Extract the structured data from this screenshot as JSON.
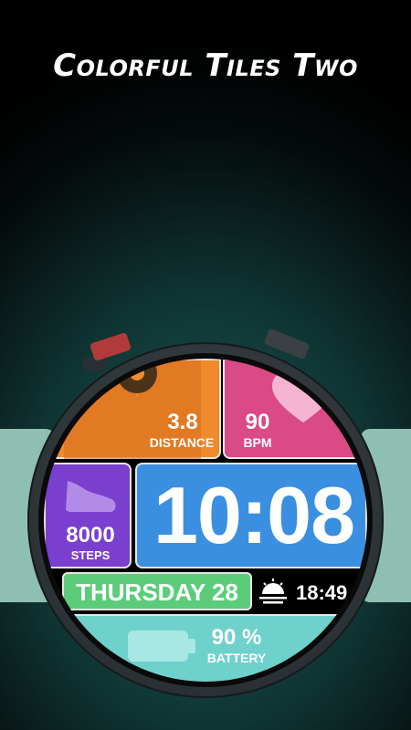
{
  "title": "Colorful Tiles Two",
  "distance": {
    "value": "3.8",
    "label": "DISTANCE"
  },
  "heart": {
    "value": "90",
    "label": "BPM"
  },
  "steps": {
    "value": "8000",
    "label": "STEPS"
  },
  "time": "10:08",
  "date": "THURSDAY 28",
  "sunset_time": "18:49",
  "battery": {
    "value": "90 %",
    "label": "BATTERY",
    "level": 0.9
  },
  "colors": {
    "distance_tile": "#f08a2c",
    "heart_tile": "#d94a86",
    "steps_tile": "#7b3fcf",
    "time_tile": "#3b8fe0",
    "date_tile": "#5ccc7a",
    "battery_tile": "#6fd1cc",
    "button": "#b33a3a"
  },
  "icons": [
    "shoe-icon",
    "heart-icon",
    "map-pin-icon",
    "sunset-icon",
    "battery-icon"
  ]
}
